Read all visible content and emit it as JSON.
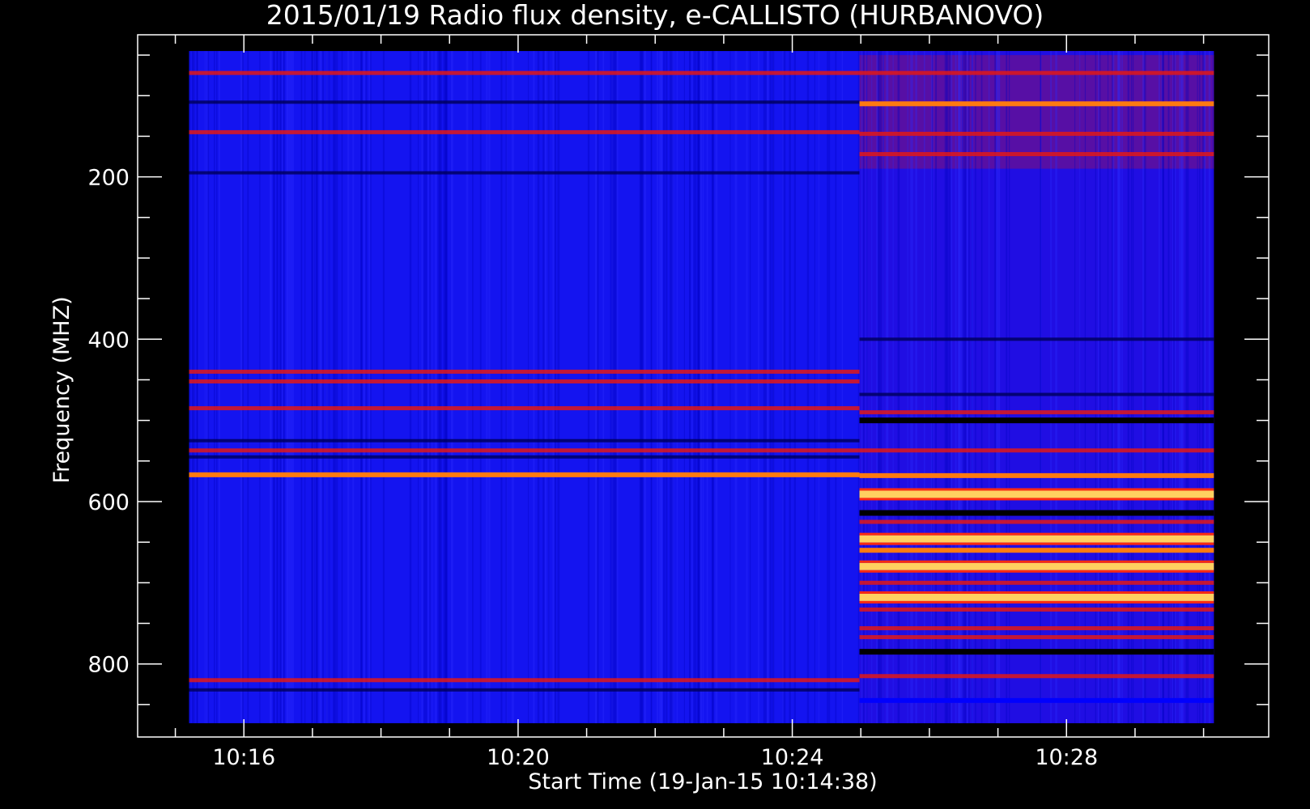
{
  "chart_data": {
    "type": "heatmap",
    "title": "2015/01/19  Radio flux density, e-CALLISTO (HURBANOVO)",
    "xlabel": "Start Time (19-Jan-15 10:14:38)",
    "ylabel": "Frequency (MHZ)",
    "x_ticks": [
      "10:16",
      "10:20",
      "10:24",
      "10:28"
    ],
    "x_tick_values_min": [
      16,
      20,
      24,
      28
    ],
    "y_ticks": [
      "200",
      "400",
      "600",
      "800"
    ],
    "y_tick_values": [
      200,
      400,
      600,
      800
    ],
    "x_range_min": [
      14.45,
      30.95
    ],
    "y_range_mhz": [
      25,
      890
    ],
    "data_x_range_min": [
      15.2,
      30.15
    ],
    "data_y_range_mhz": [
      45,
      873
    ],
    "colormap": [
      "#000000",
      "#0000ff",
      "#ff0000",
      "#ffff66"
    ],
    "background_level": "#1414f0",
    "transition_time_min": 24.98,
    "pre_transition_bands_mhz": [
      {
        "f": 72,
        "level": "red"
      },
      {
        "f": 108,
        "level": "dark"
      },
      {
        "f": 145,
        "level": "red"
      },
      {
        "f": 195,
        "level": "dark"
      },
      {
        "f": 440,
        "level": "red"
      },
      {
        "f": 452,
        "level": "red"
      },
      {
        "f": 485,
        "level": "red"
      },
      {
        "f": 525,
        "level": "dark"
      },
      {
        "f": 537,
        "level": "red"
      },
      {
        "f": 545,
        "level": "dark"
      },
      {
        "f": 567,
        "level": "orange"
      },
      {
        "f": 820,
        "level": "red"
      },
      {
        "f": 832,
        "level": "dark"
      }
    ],
    "post_transition_bands_mhz": [
      {
        "f": 72,
        "level": "red"
      },
      {
        "f": 110,
        "level": "orange"
      },
      {
        "f": 147,
        "level": "red"
      },
      {
        "f": 172,
        "level": "red"
      },
      {
        "f": 400,
        "level": "dark"
      },
      {
        "f": 468,
        "level": "dark"
      },
      {
        "f": 490,
        "level": "red"
      },
      {
        "f": 500,
        "level": "black"
      },
      {
        "f": 537,
        "level": "red"
      },
      {
        "f": 568,
        "level": "orange"
      },
      {
        "f": 591,
        "level": "yellow"
      },
      {
        "f": 614,
        "level": "black"
      },
      {
        "f": 625,
        "level": "red"
      },
      {
        "f": 646,
        "level": "yellow"
      },
      {
        "f": 660,
        "level": "orange"
      },
      {
        "f": 680,
        "level": "yellow"
      },
      {
        "f": 700,
        "level": "red"
      },
      {
        "f": 718,
        "level": "yellow"
      },
      {
        "f": 733,
        "level": "red"
      },
      {
        "f": 756,
        "level": "red"
      },
      {
        "f": 767,
        "level": "red"
      },
      {
        "f": 785,
        "level": "black"
      },
      {
        "f": 815,
        "level": "red"
      },
      {
        "f": 845,
        "level": "blue"
      }
    ]
  }
}
